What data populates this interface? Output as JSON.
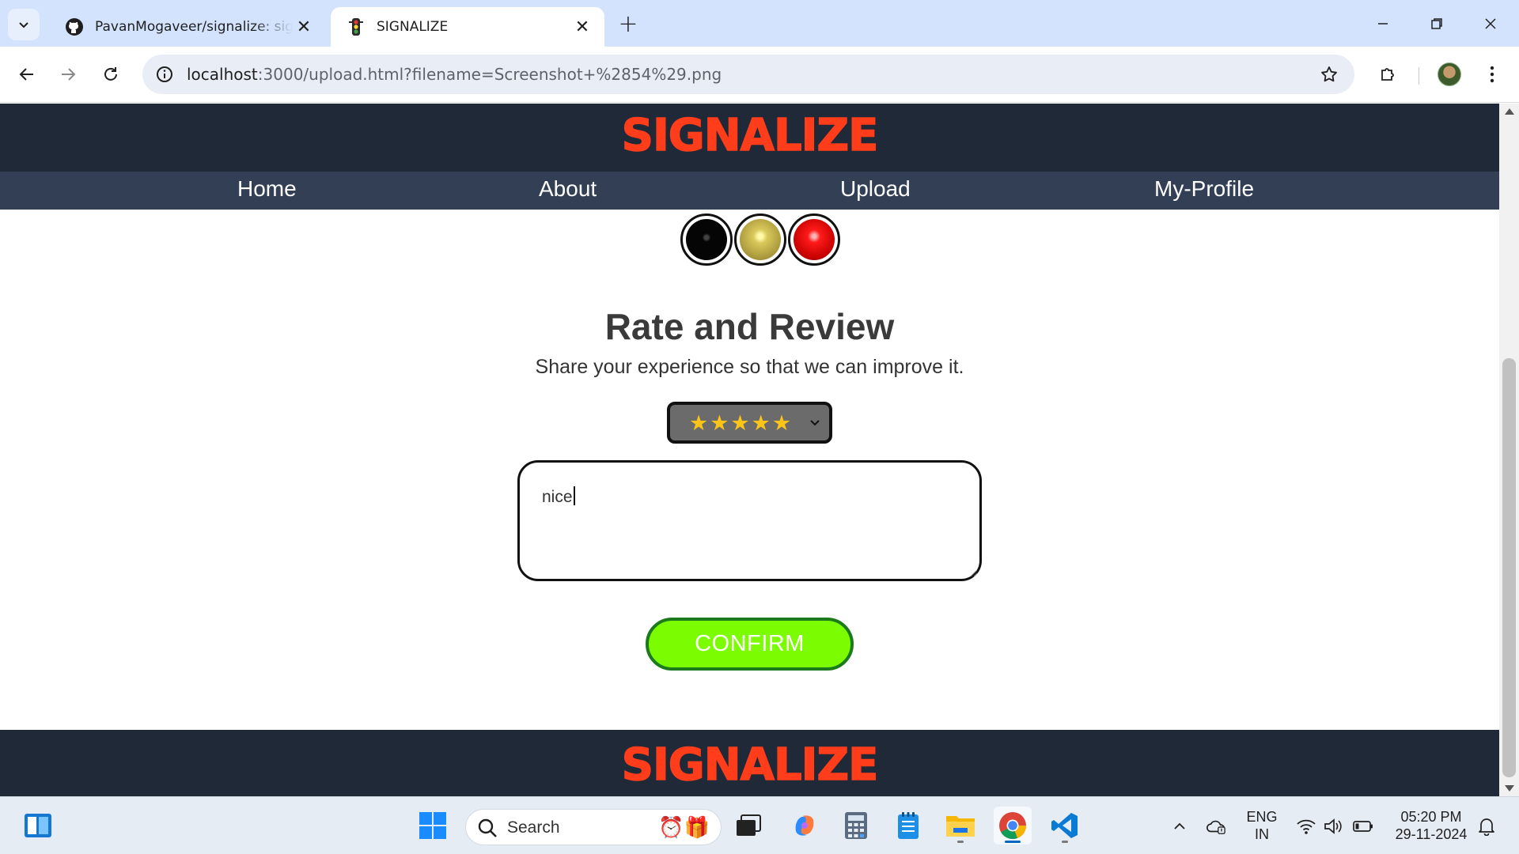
{
  "browser": {
    "tabs": [
      {
        "title": "PavanMogaveer/signalize: signa",
        "favicon": "github-icon",
        "active": false
      },
      {
        "title": "SIGNALIZE",
        "favicon": "traffic-light-icon",
        "active": true
      }
    ],
    "url_host": "localhost",
    "url_path": ":3000/upload.html?filename=Screenshot+%2854%29.png"
  },
  "site": {
    "brand": "SIGNALIZE",
    "nav": [
      {
        "label": "Home"
      },
      {
        "label": "About"
      },
      {
        "label": "Upload"
      },
      {
        "label": "My-Profile"
      }
    ],
    "footer_brand": "SIGNALIZE"
  },
  "traffic_lights": [
    {
      "color": "black",
      "hex": "#050505"
    },
    {
      "color": "yellow",
      "hex": "#c8b94f"
    },
    {
      "color": "red",
      "hex": "#e00000"
    }
  ],
  "review": {
    "heading": "Rate and Review",
    "subheading": "Share your experience so that we can improve it.",
    "rating_display": "★★★★★",
    "rating_value": 5,
    "rating_max": 5,
    "text": "nice",
    "confirm_label": "CONFIRM"
  },
  "colors": {
    "brand": "#ff3d1a",
    "header_bg": "#1f2937",
    "nav_bg": "#333f54",
    "confirm_bg": "#7cfc00",
    "confirm_border": "#1b7a1b",
    "star": "#fcc419"
  },
  "taskbar": {
    "search_label": "Search",
    "lang_top": "ENG",
    "lang_bottom": "IN",
    "time": "05:20 PM",
    "date": "29-11-2024",
    "apps": [
      "widgets-icon",
      "start-icon",
      "task-view-icon",
      "copilot-icon",
      "calculator-icon",
      "notepad-icon",
      "file-explorer-icon",
      "chrome-icon",
      "vscode-icon"
    ]
  }
}
